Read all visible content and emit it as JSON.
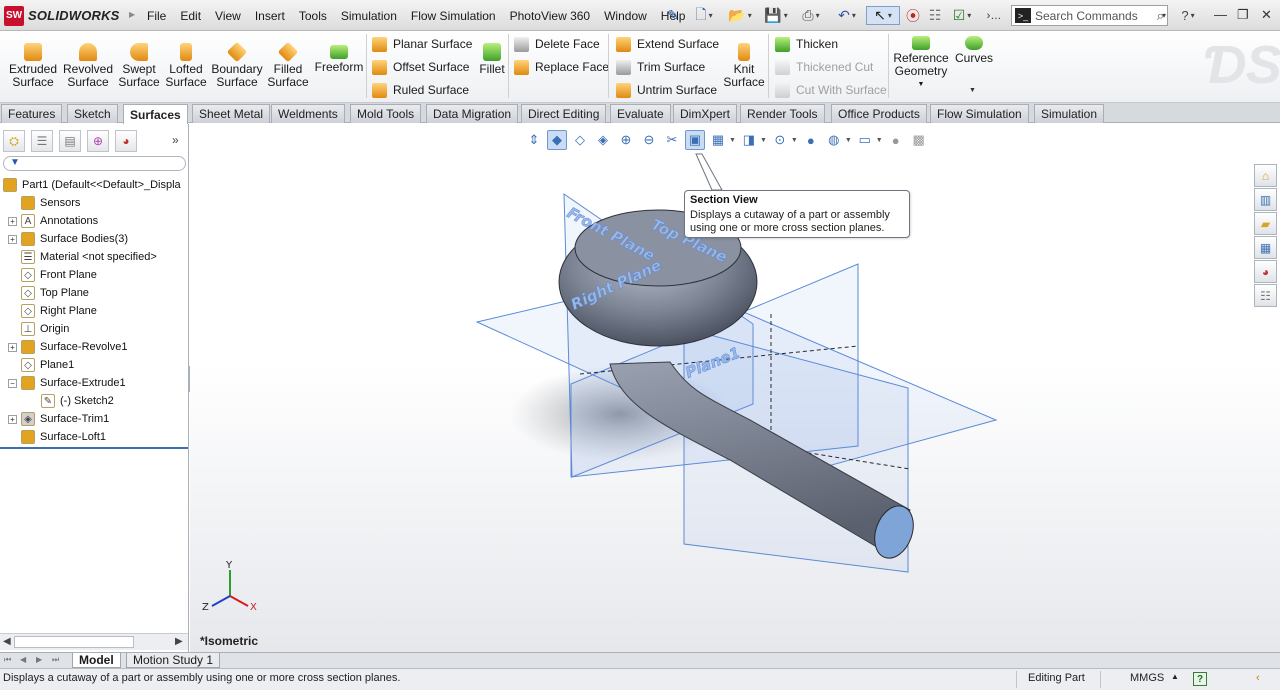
{
  "app": {
    "brand": "SOLIDWORKS",
    "brand_badge": "SW",
    "menus": [
      "File",
      "Edit",
      "View",
      "Insert",
      "Tools",
      "Simulation",
      "Flow Simulation",
      "PhotoView 360",
      "Window",
      "Help"
    ],
    "search_placeholder": "Search Commands"
  },
  "ribbon": {
    "big_buttons": [
      {
        "label": "Extruded\nSurface",
        "icon": "extruded-surface-icon"
      },
      {
        "label": "Revolved\nSurface",
        "icon": "revolved-surface-icon"
      },
      {
        "label": "Swept\nSurface",
        "icon": "swept-surface-icon"
      },
      {
        "label": "Lofted\nSurface",
        "icon": "lofted-surface-icon"
      },
      {
        "label": "Boundary\nSurface",
        "icon": "boundary-surface-icon"
      },
      {
        "label": "Filled\nSurface",
        "icon": "filled-surface-icon"
      },
      {
        "label": "Freeform",
        "icon": "freeform-icon"
      }
    ],
    "col1": [
      "Planar Surface",
      "Offset Surface",
      "Ruled Surface"
    ],
    "fillet": "Fillet",
    "col2": [
      "Delete Face",
      "Replace Face"
    ],
    "col3": [
      "Extend Surface",
      "Trim Surface",
      "Untrim Surface"
    ],
    "knit": "Knit\nSurface",
    "col4": [
      "Thicken",
      "Thickened Cut",
      "Cut With Surface"
    ],
    "reference_geometry": "Reference\nGeometry",
    "curves": "Curves"
  },
  "tabs": [
    "Features",
    "Sketch",
    "Surfaces",
    "Sheet Metal",
    "Weldments",
    "Mold Tools",
    "Data Migration",
    "Direct Editing",
    "Evaluate",
    "DimXpert",
    "Render Tools",
    "Office Products",
    "Flow Simulation",
    "Simulation"
  ],
  "active_tab": "Surfaces",
  "tree": [
    {
      "label": "Part1  (Default<<Default>_Displa",
      "icon": "part-icon",
      "expander": "none",
      "indent": 0
    },
    {
      "label": "Sensors",
      "icon": "sensor-icon",
      "expander": "none",
      "indent": 1
    },
    {
      "label": "Annotations",
      "icon": "annotations-icon",
      "expander": "+",
      "indent": 1
    },
    {
      "label": "Surface Bodies(3)",
      "icon": "surface-bodies-icon",
      "expander": "+",
      "indent": 1
    },
    {
      "label": "Material <not specified>",
      "icon": "material-icon",
      "expander": "none",
      "indent": 1
    },
    {
      "label": "Front Plane",
      "icon": "plane-icon",
      "expander": "none",
      "indent": 1
    },
    {
      "label": "Top Plane",
      "icon": "plane-icon",
      "expander": "none",
      "indent": 1
    },
    {
      "label": "Right Plane",
      "icon": "plane-icon",
      "expander": "none",
      "indent": 1
    },
    {
      "label": "Origin",
      "icon": "origin-icon",
      "expander": "none",
      "indent": 1
    },
    {
      "label": "Surface-Revolve1",
      "icon": "surface-revolve-icon",
      "expander": "+",
      "indent": 1
    },
    {
      "label": "Plane1",
      "icon": "plane-icon",
      "expander": "none",
      "indent": 1
    },
    {
      "label": "Surface-Extrude1",
      "icon": "surface-extrude-icon",
      "expander": "−",
      "indent": 1
    },
    {
      "label": "(-) Sketch2",
      "icon": "sketch-icon",
      "expander": "none",
      "indent": 2
    },
    {
      "label": "Surface-Trim1",
      "icon": "surface-trim-icon",
      "expander": "+",
      "indent": 1
    },
    {
      "label": "Surface-Loft1",
      "icon": "surface-loft-icon",
      "expander": "none",
      "indent": 1
    }
  ],
  "graphics": {
    "tooltip_title": "Section View",
    "tooltip_body": "Displays a cutaway of a part or assembly using one or more cross section planes.",
    "view_name": "*Isometric",
    "plane_labels": {
      "front": "Front Plane",
      "top": "Top Plane",
      "right": "Right Plane",
      "plane1": "Plane1"
    },
    "triad": {
      "x": "X",
      "y": "Y",
      "z": "Z"
    }
  },
  "bottom_tabs": [
    "Model",
    "Motion Study 1"
  ],
  "status": {
    "message": "Displays a cutaway of a part or assembly using one or more cross section planes.",
    "mode": "Editing Part",
    "units": "MMGS"
  },
  "colors": {
    "accent": "#3c6fb8",
    "brand": "#c8102e",
    "plane": "#5b8ad6"
  }
}
